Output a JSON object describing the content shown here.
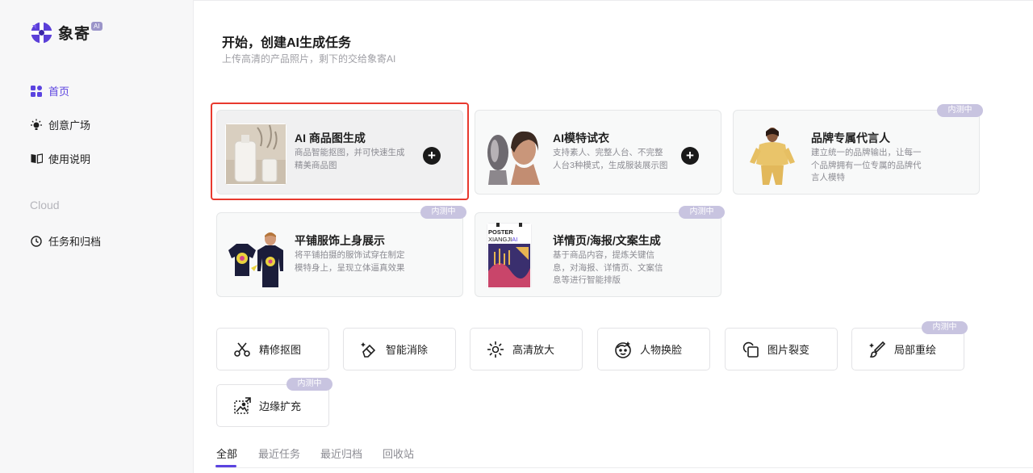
{
  "logo": {
    "text": "象寄",
    "badge": "AI"
  },
  "sidebar": {
    "items": [
      {
        "label": "首页",
        "icon": "grid-icon",
        "active": true
      },
      {
        "label": "创意广场",
        "icon": "bulb-icon",
        "active": false
      },
      {
        "label": "使用说明",
        "icon": "book-icon",
        "active": false
      }
    ],
    "section_label": "Cloud",
    "cloud_items": [
      {
        "label": "任务和归档",
        "icon": "clock-icon"
      }
    ]
  },
  "header": {
    "title": "开始，创建AI生成任务",
    "subtitle": "上传高清的产品照片，剩下的交给象寄AI"
  },
  "cards": [
    {
      "title": "AI 商品图生成",
      "desc": "商品智能抠图，并可快速生成精美商品图",
      "plus": "+",
      "badge": ""
    },
    {
      "title": "AI模特试衣",
      "desc": "支持素人、完整人台、不完整人台3种模式，生成服装展示图",
      "plus": "+",
      "badge": ""
    },
    {
      "title": "品牌专属代言人",
      "desc": "建立统一的品牌输出，让每一个品牌拥有一位专属的品牌代言人模特",
      "plus": "",
      "badge": "内测中"
    },
    {
      "title": "平铺服饰上身展示",
      "desc": "将平铺拍摄的服饰试穿在制定模特身上，呈现立体逼真效果",
      "plus": "",
      "badge": "内测中"
    },
    {
      "title": "详情页/海报/文案生成",
      "desc": "基于商品内容，提炼关键信息，对海报、详情页、文案信息等进行智能排版",
      "plus": "",
      "badge": "内测中"
    }
  ],
  "poster_thumb": {
    "line1": "POSTER",
    "line2": "XIANGJI",
    "line2_accent": "AI"
  },
  "tools": [
    {
      "label": "精修抠图",
      "icon": "scissors-icon",
      "badge": ""
    },
    {
      "label": "智能消除",
      "icon": "eraser-icon",
      "badge": ""
    },
    {
      "label": "高清放大",
      "icon": "sparkle-icon",
      "badge": ""
    },
    {
      "label": "人物换脸",
      "icon": "face-icon",
      "badge": ""
    },
    {
      "label": "图片裂变",
      "icon": "copy-icon",
      "badge": ""
    },
    {
      "label": "局部重绘",
      "icon": "brush-icon",
      "badge": "内测中"
    },
    {
      "label": "边缘扩充",
      "icon": "expand-image-icon",
      "badge": "内测中"
    }
  ],
  "tabs": [
    {
      "label": "全部",
      "active": true
    },
    {
      "label": "最近任务",
      "active": false
    },
    {
      "label": "最近归档",
      "active": false
    },
    {
      "label": "回收站",
      "active": false
    }
  ],
  "colors": {
    "accent": "#5b43e0",
    "badge": "#c8c4e0",
    "highlight": "#e8392e"
  }
}
